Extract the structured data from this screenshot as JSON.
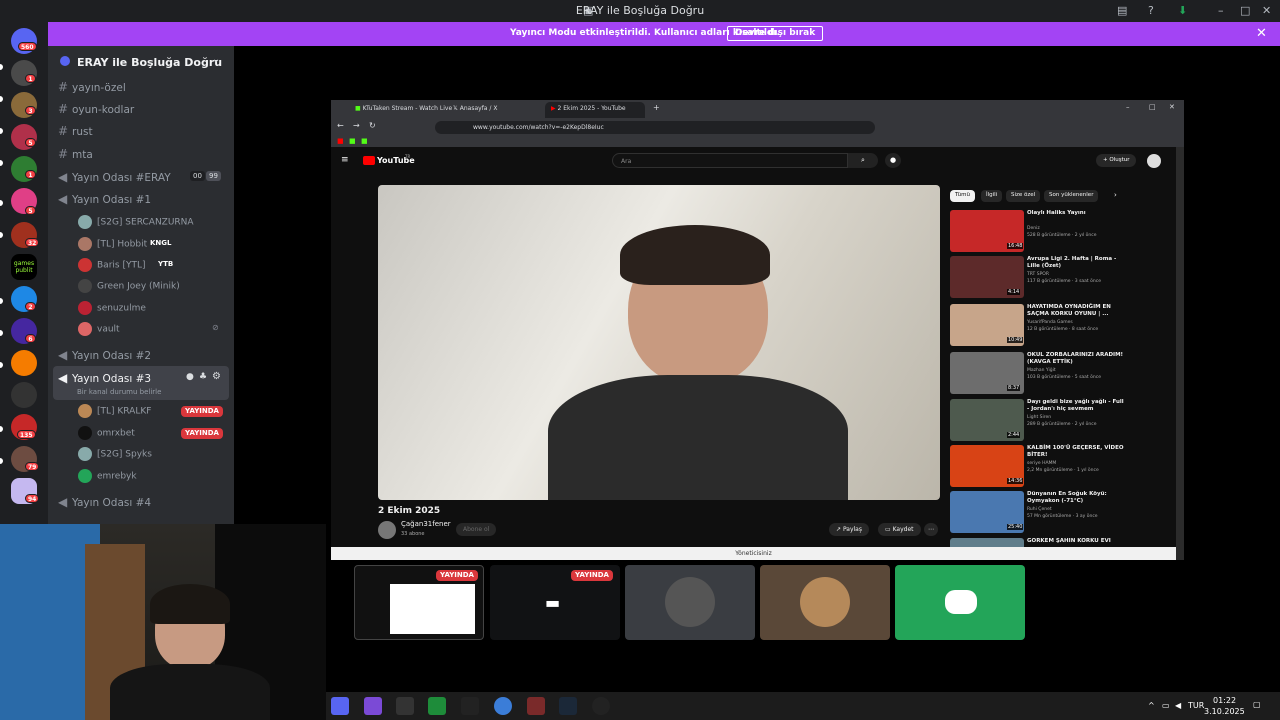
{
  "window": {
    "title": "ERAY ile Boşluğa Doğru"
  },
  "banner": {
    "message": "Yayıncı Modu etkinleştirildi. Kullanıcı adları kısaltıldı.",
    "button": "Devre dışı bırak",
    "close": "✕"
  },
  "servers": {
    "home_badge": "560",
    "badges": [
      "1",
      "3",
      "5",
      "1",
      "5",
      "32",
      "2",
      "6",
      "135",
      "79",
      "94"
    ],
    "games_label": "games\npublit"
  },
  "channels": {
    "guild_name": "ERAY ile Boşluğa Doğru",
    "text": [
      "yayın-özel",
      "oyun-kodlar",
      "rust",
      "mta"
    ],
    "voice_eray": "Yayın Odası #ERAY",
    "voice_eray_counts": [
      "00",
      "99"
    ],
    "voice1": "Yayın Odası #1",
    "voice1_users": [
      "[S2G] SERCANZURNA",
      "[TL] Hobbit",
      "Baris [YTL]",
      "Green Joey (Minik)",
      "senuzulme",
      "vault"
    ],
    "voice1_activity": [
      "KNGL",
      "YTB"
    ],
    "voice2": "Yayın Odası #2",
    "voice3": "Yayın Odası #3",
    "voice3_status": "Bir kanal durumu belirle",
    "voice3_users": [
      "[TL] KRALKF",
      "omrxbet",
      "[S2G] Spyks",
      "emrebyk"
    ],
    "live_label": "YAYINDA",
    "voice4": "Yayın Odası #4"
  },
  "browser": {
    "tabs": [
      "KTuTaken Stream - Watch Live -",
      "Anasayfa / X",
      "2 Ekim 2025 - YouTube"
    ],
    "url": "www.youtube.com/watch?v=-e2KepDl8eIuc",
    "yt_logo": "YouTube",
    "yt_region": "TR",
    "search_placeholder": "Ara",
    "create": "Oluştur",
    "video_title": "2 Ekim 2025",
    "channel": "Çağan31fener",
    "subs": "33 abone",
    "subscribe": "Abone ol",
    "share": "Paylaş",
    "save": "Kaydet",
    "chips": [
      "Tümü",
      "İlgili",
      "Size özel",
      "Son yüklenenler"
    ],
    "recs": [
      {
        "title": "Olaylı Haliks Yayını",
        "ch": "Deniz",
        "meta": "528 B görüntüleme · 2 yıl önce",
        "dur": "16:48"
      },
      {
        "title": "Avrupa Ligi 2. Hafta | Roma - Lille (Özet)",
        "ch": "TRT SPOR",
        "meta": "117 B görüntüleme · 3 saat önce",
        "dur": "4:14"
      },
      {
        "title": "HAYATIMDA OYNADIĞIM EN SAÇMA KORKU OYUNU | ...",
        "ch": "YusarifPanda Games",
        "meta": "12 B görüntüleme · 8 saat önce",
        "dur": "10:49"
      },
      {
        "title": "OKUL ZORBALARINIZI ARADIM! (KAVGA ETTİK)",
        "ch": "Mazhan Yiğit",
        "meta": "103 B görüntüleme · 5 saat önce",
        "dur": "8:37"
      },
      {
        "title": "Dayı geldi bize yağlı yağlı - Full - Jordan'ı hiç sevmem",
        "ch": "Light Siren",
        "meta": "289 B görüntüleme · 2 yıl önce",
        "dur": "2:44"
      },
      {
        "title": "KALBİM 100'Ü GEÇERSE, VİDEO BİTER!",
        "ch": "seriye HAMM",
        "meta": "2,2 Mn görüntüleme · 1 yıl önce",
        "dur": "14:36"
      },
      {
        "title": "Dünyanın En Soğuk Köyü: Oymyakon (-71°C)",
        "ch": "Ruhi Çenet",
        "meta": "57 Mn görüntüleme · 3 ay önce",
        "dur": "25:40"
      },
      {
        "title": "GÖRKEM ŞAHİN KORKU EVİ",
        "ch": "",
        "meta": "",
        "dur": ""
      }
    ],
    "footer": "Yöneticisiniz"
  },
  "tiles": {
    "live": "YAYINDA"
  },
  "taskbar": {
    "lang": "TUR",
    "time": "01:22",
    "date": "3.10.2025"
  },
  "colors": {
    "accent": "#a344f4",
    "live": "#da373c",
    "discord": "#23a559"
  }
}
